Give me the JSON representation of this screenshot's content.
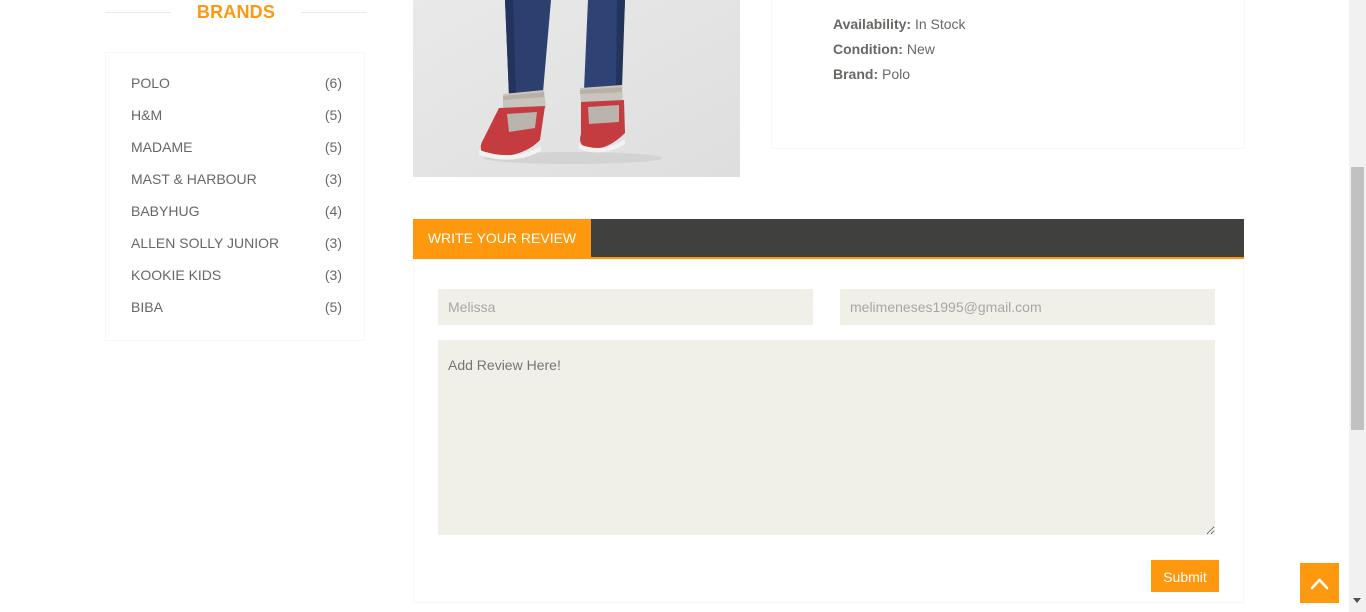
{
  "brands": {
    "title": "BRANDS",
    "items": [
      {
        "name": "POLO",
        "count": "(6)"
      },
      {
        "name": "H&M",
        "count": "(5)"
      },
      {
        "name": "MADAME",
        "count": "(5)"
      },
      {
        "name": "MAST & HARBOUR",
        "count": "(3)"
      },
      {
        "name": "BABYHUG",
        "count": "(4)"
      },
      {
        "name": "ALLEN SOLLY JUNIOR",
        "count": "(3)"
      },
      {
        "name": "KOOKIE KIDS",
        "count": "(3)"
      },
      {
        "name": "BIBA",
        "count": "(5)"
      }
    ]
  },
  "product": {
    "availability_label": "Availability:",
    "availability_value": "In Stock",
    "condition_label": "Condition:",
    "condition_value": "New",
    "brand_label": "Brand:",
    "brand_value": "Polo"
  },
  "review": {
    "tab_label": "WRITE YOUR REVIEW",
    "name_value": "Melissa",
    "email_value": "melimeneses1995@gmail.com",
    "review_placeholder": "Add Review Here!",
    "submit_label": "Submit"
  },
  "colors": {
    "accent": "#FE980F",
    "tab_bar": "#40403E",
    "field_bg": "#F0F0E9"
  },
  "icons": {
    "scroll_up": "chevron-up-icon"
  }
}
